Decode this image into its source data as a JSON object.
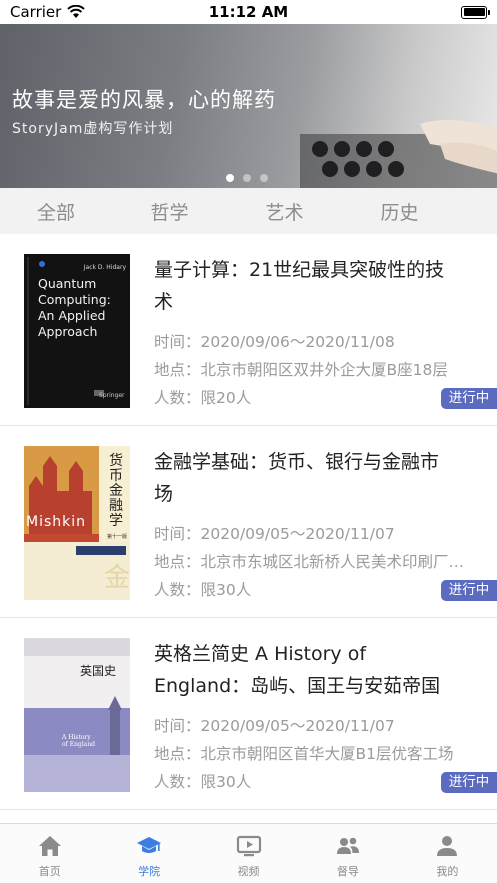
{
  "status_bar": {
    "carrier": "Carrier",
    "time": "11:12 AM"
  },
  "banner": {
    "title": "故事是爱的风暴，心的解药",
    "subtitle": "StoryJam虚构写作计划",
    "page_count": 3,
    "active_page": 1
  },
  "categories": [
    "全部",
    "哲学",
    "艺术",
    "历史"
  ],
  "courses": [
    {
      "title": "量子计算：21世纪最具突破性的技术",
      "time": "时间：2020/09/06～2020/11/08",
      "location": "地点：北京市朝阳区双井外企大厦B座18层",
      "capacity": "人数：限20人",
      "status": "进行中",
      "cover": {
        "author": "Jack D. Hidary",
        "lines": [
          "Quantum",
          "Computing:",
          "An Applied",
          "Approach"
        ],
        "publisher": "Springer"
      }
    },
    {
      "title": "金融学基础：货币、银行与金融市场",
      "time": "时间：2020/09/05～2020/11/07",
      "location": "地点：北京市东城区北新桥人民美术印刷厂文创园",
      "capacity": "人数：限30人",
      "status": "进行中",
      "cover": {
        "vertical_title": "货币金融学",
        "name": "Mishkin",
        "edition": "第十一版"
      }
    },
    {
      "title": "英格兰简史 A History of England：岛屿、国王与安茹帝国",
      "time": "时间：2020/09/05～2020/11/07",
      "location": "地点：北京市朝阳区首华大厦B1层优客工场",
      "capacity": "人数：限30人",
      "status": "进行中",
      "cover": {
        "cn_title": "英国史",
        "en_line1": "A History",
        "en_line2": "of England"
      }
    }
  ],
  "tab_bar": {
    "active": "学院",
    "tabs": [
      {
        "label": "首页",
        "icon": "home-icon"
      },
      {
        "label": "学院",
        "icon": "graduation-cap-icon"
      },
      {
        "label": "视频",
        "icon": "video-play-icon"
      },
      {
        "label": "督导",
        "icon": "group-icon"
      },
      {
        "label": "我的",
        "icon": "person-icon"
      }
    ]
  }
}
